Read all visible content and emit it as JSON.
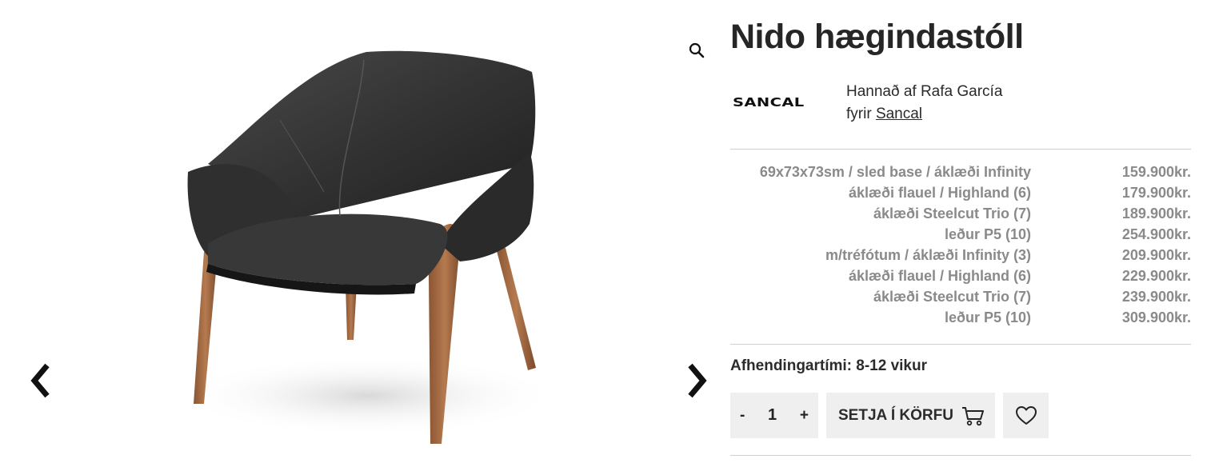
{
  "product": {
    "title": "Nido hægindastóll",
    "brand_logo_text": "SANCAL",
    "designer_line1": "Hannað af Rafa García",
    "designer_prefix": "fyrir",
    "designer_brand_link": "Sancal"
  },
  "variants": [
    {
      "name": "69x73x73sm / sled base / áklæði Infinity",
      "price": "159.900kr."
    },
    {
      "name": "áklæði flauel / Highland (6)",
      "price": "179.900kr."
    },
    {
      "name": "áklæði Steelcut Trio (7)",
      "price": "189.900kr."
    },
    {
      "name": "leður P5 (10)",
      "price": "254.900kr."
    },
    {
      "name": "m/tréfótum / áklæði Infinity (3)",
      "price": "209.900kr."
    },
    {
      "name": "áklæði flauel / Highland (6)",
      "price": "229.900kr."
    },
    {
      "name": "áklæði Steelcut Trio (7)",
      "price": "239.900kr."
    },
    {
      "name": "leður P5 (10)",
      "price": "309.900kr."
    }
  ],
  "delivery": "Afhendingartími: 8-12 vikur",
  "quantity": {
    "minus": "-",
    "value": "1",
    "plus": "+"
  },
  "cart_button_label": "SETJA Í KÖRFU",
  "icons": {
    "zoom": "magnifier-icon",
    "prev": "chevron-left-icon",
    "next": "chevron-right-icon",
    "cart": "shopping-cart-icon",
    "wishlist": "heart-icon"
  },
  "colors": {
    "text": "#2b2b2b",
    "muted": "#8a8a8a",
    "button_bg": "#efefef",
    "divider": "#cfcfcf"
  }
}
